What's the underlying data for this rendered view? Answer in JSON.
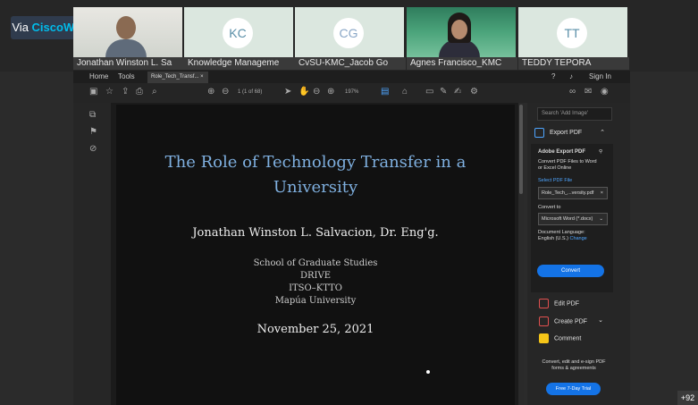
{
  "webex": {
    "badge_prefix": "Via ",
    "badge_brand": "CiscoWebex",
    "participants": [
      {
        "name": "Jonathan Winston L. Sa",
        "initials": ""
      },
      {
        "name": "Knowledge Manageme",
        "initials": "KC"
      },
      {
        "name": "CvSU-KMC_Jacob Go",
        "initials": "CG"
      },
      {
        "name": "Agnes Francisco_KMC",
        "initials": ""
      },
      {
        "name": "TEDDY TEPORA",
        "initials": "TT"
      }
    ],
    "overflow_count": "+92"
  },
  "acrobat": {
    "menu": {
      "home": "Home",
      "tools": "Tools",
      "sign_in": "Sign In"
    },
    "tab_label": "Role_Tech_Transf...",
    "toolbar": {
      "page_indicator": "1  (1 of 68)",
      "zoom": "197%"
    },
    "document": {
      "title_line1": "The Role of Technology Transfer in a",
      "title_line2": "University",
      "author": "Jonathan Winston L. Salvacion, Dr. Eng'g.",
      "aff1": "School of Graduate Studies",
      "aff2": "DRIVE",
      "aff3": "ITSO–KTTO",
      "aff4": "Mapúa University",
      "date": "November 25, 2021"
    },
    "panel": {
      "search_placeholder": "Search 'Add Image'",
      "export_label": "Export PDF",
      "card_title": "Adobe Export PDF",
      "card_desc1": "Convert PDF Files to Word",
      "card_desc2": "or Excel Online",
      "select_label": "Select PDF File",
      "file_value": "Role_Tech_...versity.pdf",
      "convert_to_label": "Convert to",
      "convert_to_value": "Microsoft Word (*.docx)",
      "doc_lang_label": "Document Language:",
      "doc_lang_value": "English (U.S.)",
      "change_link": "Change",
      "convert_button": "Convert",
      "tools": [
        "Edit PDF",
        "Create PDF",
        "Comment"
      ],
      "promo_line1": "Convert, edit and e-sign PDF",
      "promo_line2": "forms & agreements",
      "trial_button": "Free 7-Day Trial"
    }
  },
  "colors": {
    "accent_blue": "#1473e6",
    "link_blue": "#4ea5ff",
    "title_blue": "#7fb0e0",
    "webex_cyan": "#00bceb"
  }
}
